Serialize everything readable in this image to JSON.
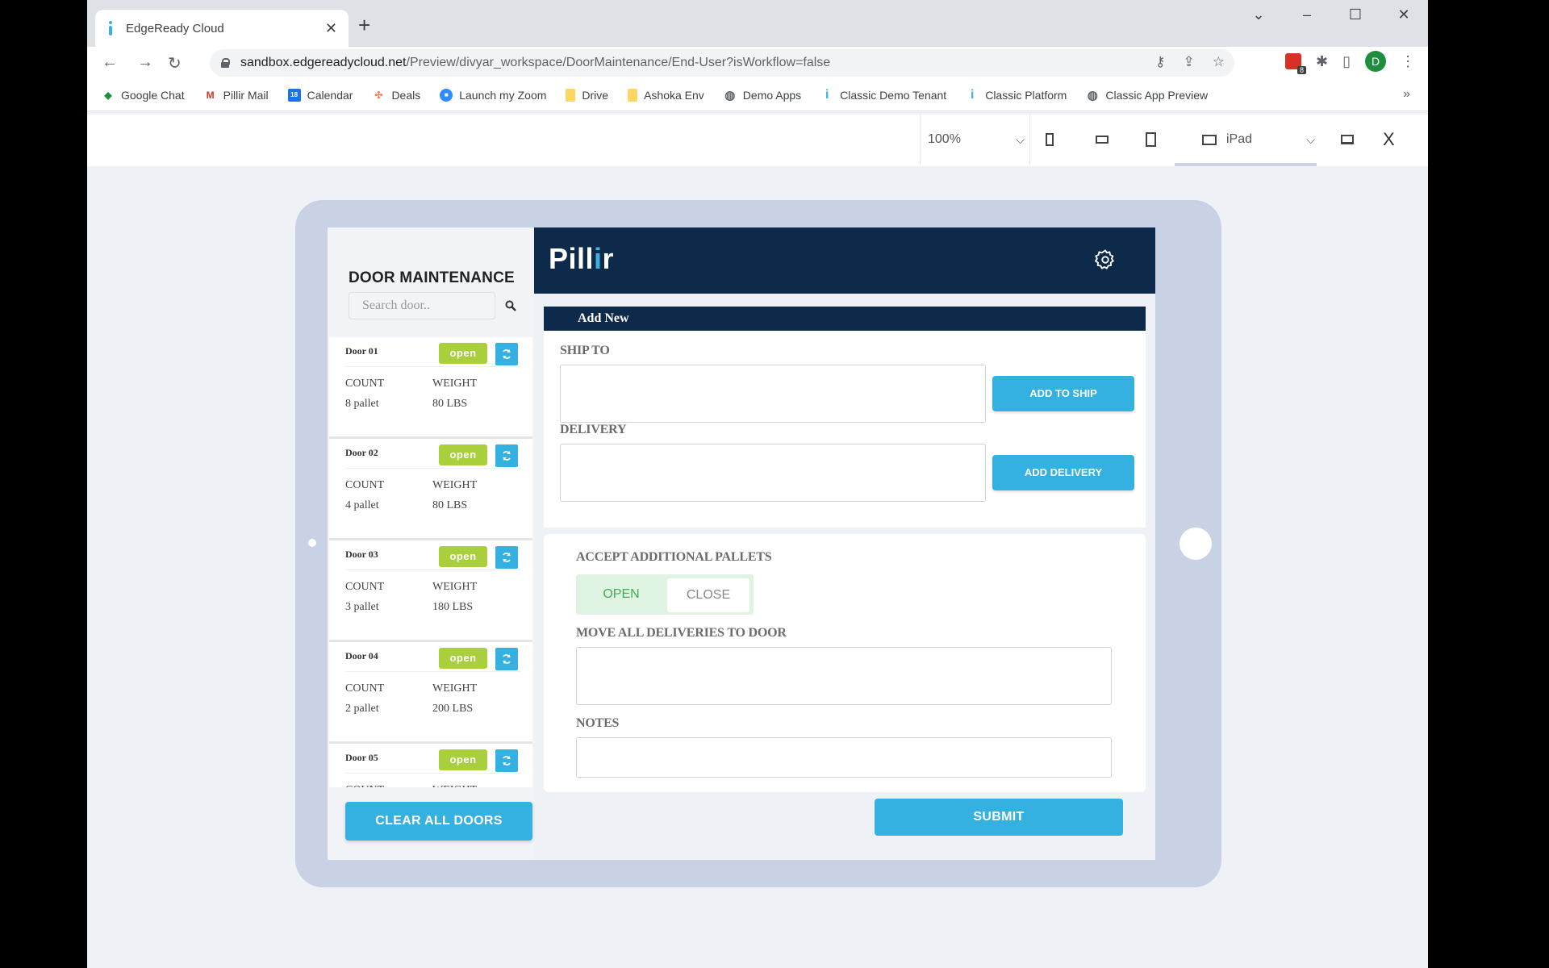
{
  "browser": {
    "tab_title": "EdgeReady Cloud",
    "url_host": "sandbox.edgereadycloud.net",
    "url_path": "/Preview/divyar_workspace/DoorMaintenance/End-User?isWorkflow=false",
    "extension_badge": "8",
    "profile_initial": "D",
    "bookmarks": [
      {
        "label": "Google Chat",
        "icon": "google-chat-icon"
      },
      {
        "label": "Pillir Mail",
        "icon": "gmail-icon"
      },
      {
        "label": "Calendar",
        "icon": "calendar-icon"
      },
      {
        "label": "Deals",
        "icon": "hubspot-icon"
      },
      {
        "label": "Launch my Zoom",
        "icon": "zoom-icon"
      },
      {
        "label": "Drive",
        "icon": "folder-icon"
      },
      {
        "label": "Ashoka Env",
        "icon": "folder-icon"
      },
      {
        "label": "Demo Apps",
        "icon": "globe-icon"
      },
      {
        "label": "Classic Demo Tenant",
        "icon": "info-icon"
      },
      {
        "label": "Classic Platform",
        "icon": "info-icon"
      },
      {
        "label": "Classic App Preview",
        "icon": "globe-icon"
      }
    ]
  },
  "preview_toolbar": {
    "zoom_level": "100%",
    "device_label": "iPad",
    "close_label": "X"
  },
  "app": {
    "sidebar_title": "DOOR MAINTENANCE",
    "search_placeholder": "Search door..",
    "search_value": "",
    "count_label": "COUNT",
    "weight_label": "WEIGHT",
    "doors": [
      {
        "name": "Door 01",
        "status": "open",
        "count": "8 pallet",
        "weight": "80 LBS"
      },
      {
        "name": "Door 02",
        "status": "open",
        "count": "4 pallet",
        "weight": "80 LBS"
      },
      {
        "name": "Door 03",
        "status": "open",
        "count": "3 pallet",
        "weight": "180 LBS"
      },
      {
        "name": "Door 04",
        "status": "open",
        "count": "2 pallet",
        "weight": "200 LBS"
      },
      {
        "name": "Door 05",
        "status": "open",
        "count": "",
        "weight": ""
      }
    ],
    "clear_all_label": "CLEAR ALL DOORS",
    "logo_prefix": "Pill",
    "logo_accent": "i",
    "logo_suffix": "r",
    "section_title": "Add New",
    "ship_to_label": "SHIP TO",
    "ship_to_value": "",
    "add_to_ship_label": "ADD TO SHIP",
    "delivery_label": "DELIVERY",
    "delivery_value": "",
    "add_delivery_label": "ADD DELIVERY",
    "accept_pallets_label": "ACCEPT ADDITIONAL PALLETS",
    "toggle_open_label": "OPEN",
    "toggle_close_label": "CLOSE",
    "toggle_selected": "OPEN",
    "move_deliveries_label": "MOVE ALL DELIVERIES TO DOOR",
    "move_deliveries_value": "",
    "notes_label": "NOTES",
    "notes_value": "",
    "submit_label": "SUBMIT"
  },
  "colors": {
    "navy": "#0e2a4a",
    "accent_blue": "#34b1e0",
    "open_green": "#a9cf3c",
    "toggle_green": "#3fae4f"
  }
}
